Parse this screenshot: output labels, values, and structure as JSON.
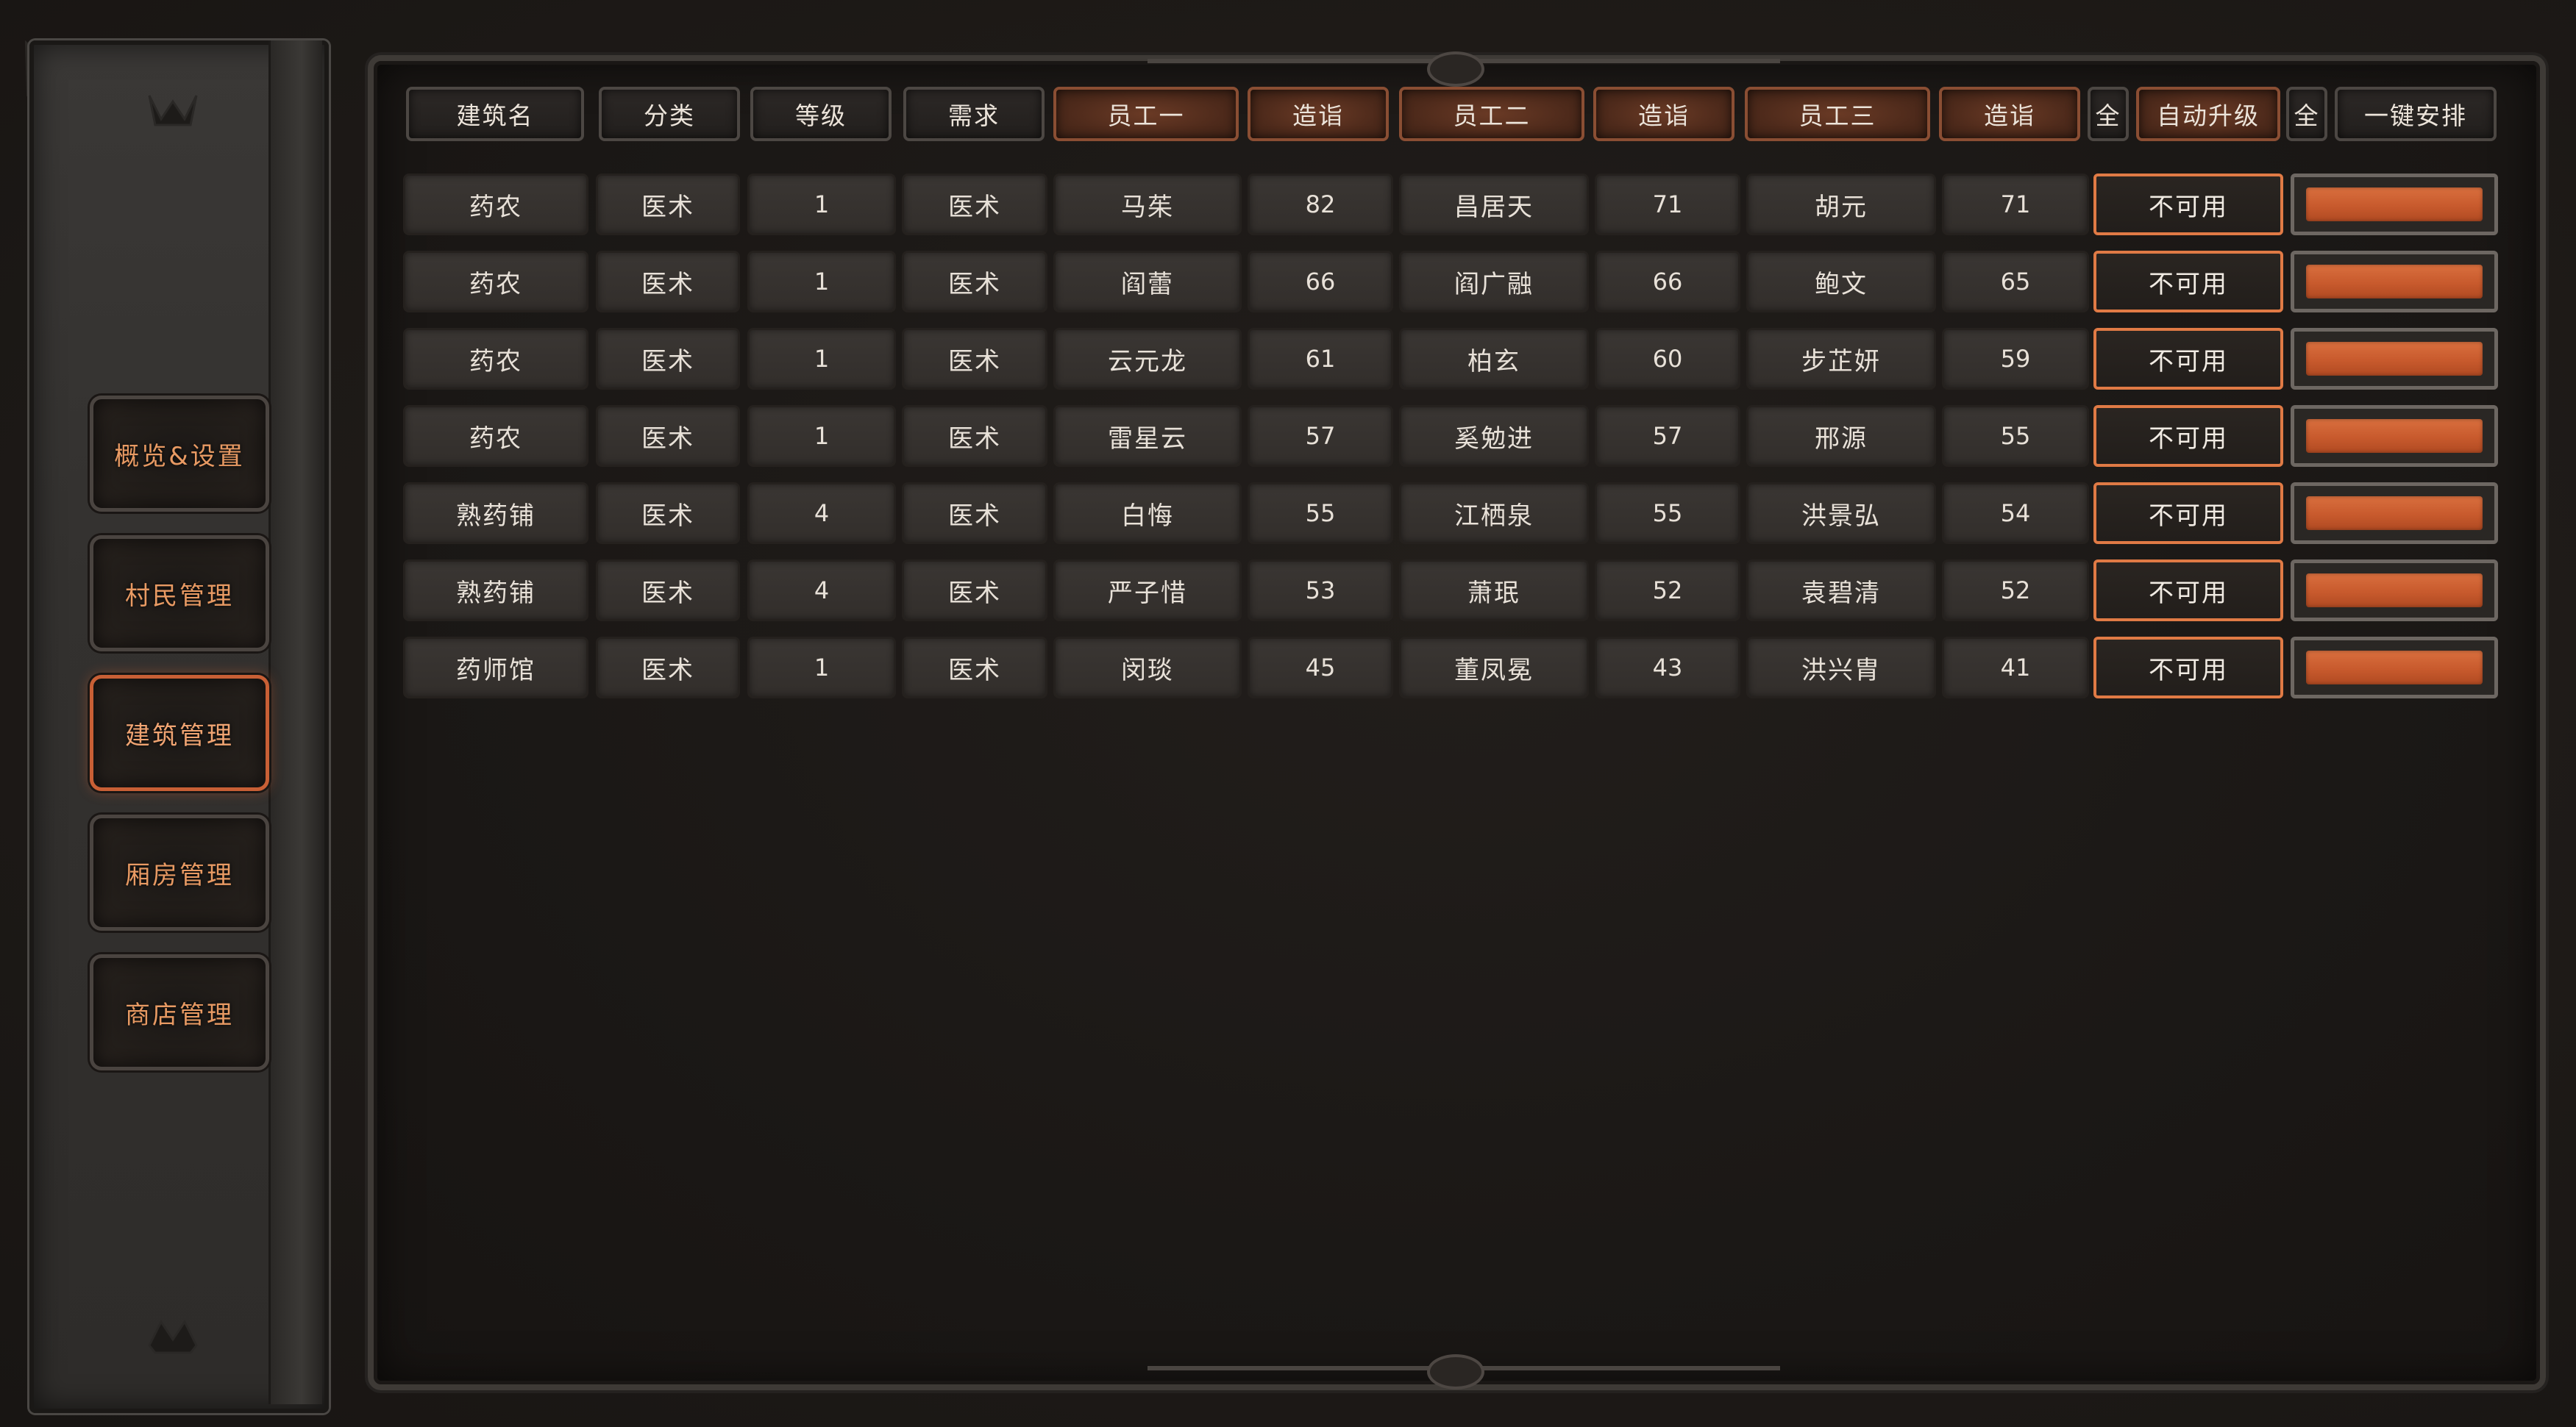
{
  "sidebar": {
    "items": [
      {
        "label": "概览&设置",
        "active": false
      },
      {
        "label": "村民管理",
        "active": false
      },
      {
        "label": "建筑管理",
        "active": true
      },
      {
        "label": "厢房管理",
        "active": false
      },
      {
        "label": "商店管理",
        "active": false
      }
    ]
  },
  "table": {
    "headers": {
      "building_name": "建筑名",
      "category": "分类",
      "level": "等级",
      "requirement": "需求",
      "staff1": "员工一",
      "skill1": "造诣",
      "staff2": "员工二",
      "skill2": "造诣",
      "staff3": "员工三",
      "skill3": "造诣",
      "all_left": "全",
      "auto_upgrade": "自动升级",
      "all_right": "全",
      "one_click_arrange": "一键安排"
    },
    "rows": [
      {
        "name": "药农",
        "category": "医术",
        "level": "1",
        "requirement": "医术",
        "staff1": "马茱",
        "skill1": "82",
        "staff2": "昌居天",
        "skill2": "71",
        "staff3": "胡元",
        "skill3": "71",
        "auto_upgrade": "不可用"
      },
      {
        "name": "药农",
        "category": "医术",
        "level": "1",
        "requirement": "医术",
        "staff1": "阎蕾",
        "skill1": "66",
        "staff2": "阎广融",
        "skill2": "66",
        "staff3": "鲍文",
        "skill3": "65",
        "auto_upgrade": "不可用"
      },
      {
        "name": "药农",
        "category": "医术",
        "level": "1",
        "requirement": "医术",
        "staff1": "云元龙",
        "skill1": "61",
        "staff2": "柏玄",
        "skill2": "60",
        "staff3": "步芷妍",
        "skill3": "59",
        "auto_upgrade": "不可用"
      },
      {
        "name": "药农",
        "category": "医术",
        "level": "1",
        "requirement": "医术",
        "staff1": "雷星云",
        "skill1": "57",
        "staff2": "奚勉进",
        "skill2": "57",
        "staff3": "邢源",
        "skill3": "55",
        "auto_upgrade": "不可用"
      },
      {
        "name": "熟药铺",
        "category": "医术",
        "level": "4",
        "requirement": "医术",
        "staff1": "白悔",
        "skill1": "55",
        "staff2": "江栖泉",
        "skill2": "55",
        "staff3": "洪景弘",
        "skill3": "54",
        "auto_upgrade": "不可用"
      },
      {
        "name": "熟药铺",
        "category": "医术",
        "level": "4",
        "requirement": "医术",
        "staff1": "严子惜",
        "skill1": "53",
        "staff2": "萧珉",
        "skill2": "52",
        "staff3": "袁碧清",
        "skill3": "52",
        "auto_upgrade": "不可用"
      },
      {
        "name": "药师馆",
        "category": "医术",
        "level": "1",
        "requirement": "医术",
        "staff1": "闵琰",
        "skill1": "45",
        "staff2": "董凤冕",
        "skill2": "43",
        "staff3": "洪兴胄",
        "skill3": "41",
        "auto_upgrade": "不可用"
      }
    ]
  },
  "colors": {
    "accent_orange": "#e07a45",
    "nav_text": "#e89a63",
    "arrange_fill": "#c85a2d"
  },
  "icons": {
    "cursor": "cursor-arrow-icon",
    "sidebar_top": "crown-emblem-icon",
    "sidebar_bottom": "crown-emblem-icon"
  }
}
